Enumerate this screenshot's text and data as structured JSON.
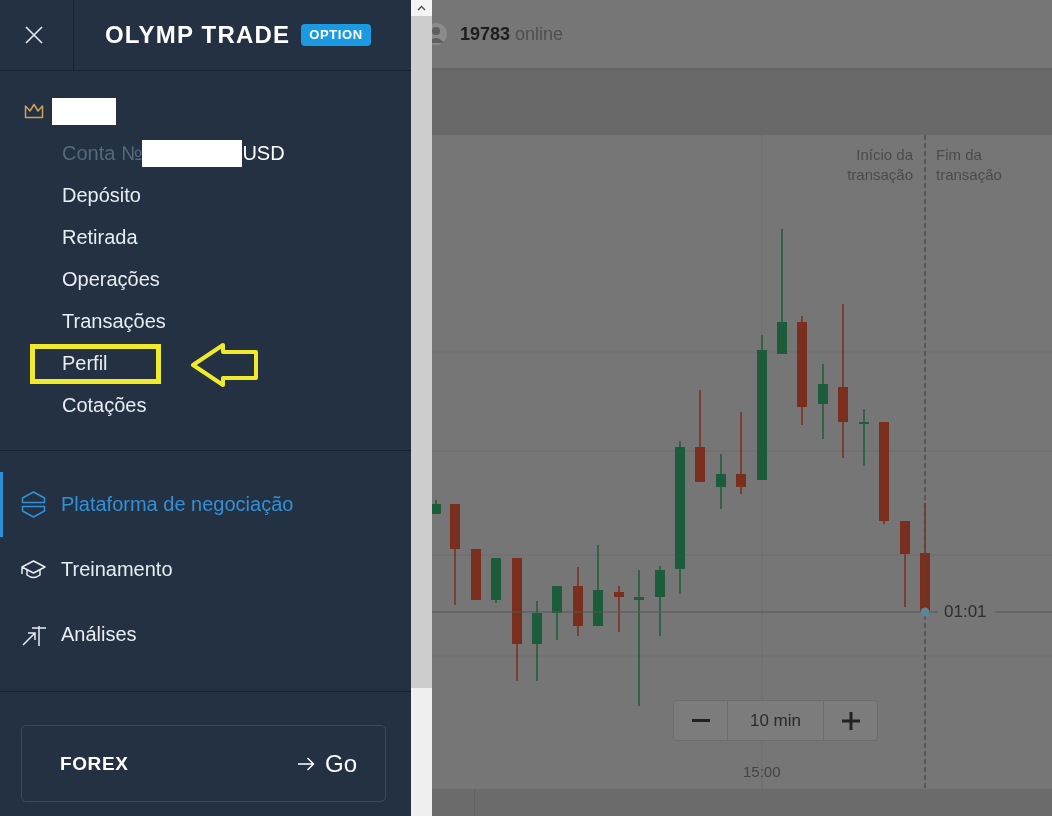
{
  "header": {
    "logo": "OLYMP TRADE",
    "badge": "OPTION"
  },
  "account": {
    "label": "Conta №",
    "currency": "USD"
  },
  "account_menu": [
    {
      "label": "Depósito",
      "highlighted": false
    },
    {
      "label": "Retirada",
      "highlighted": false
    },
    {
      "label": "Operações",
      "highlighted": false
    },
    {
      "label": "Transações",
      "highlighted": false
    },
    {
      "label": "Perfil",
      "highlighted": true
    },
    {
      "label": "Cotações",
      "highlighted": false
    }
  ],
  "nav": [
    {
      "label": "Plataforma de negociação",
      "selected": true
    },
    {
      "label": "Treinamento",
      "selected": false
    },
    {
      "label": "Análises",
      "selected": false
    }
  ],
  "forex_card": {
    "title": "FOREX",
    "action": "Go"
  },
  "top_bar": {
    "online": "**19783** online"
  },
  "chart": {
    "start_label": "Início da transação",
    "end_label": "Fim da transação",
    "timer": "01:01",
    "interval": "10 min",
    "time_label": "15:00"
  }
}
